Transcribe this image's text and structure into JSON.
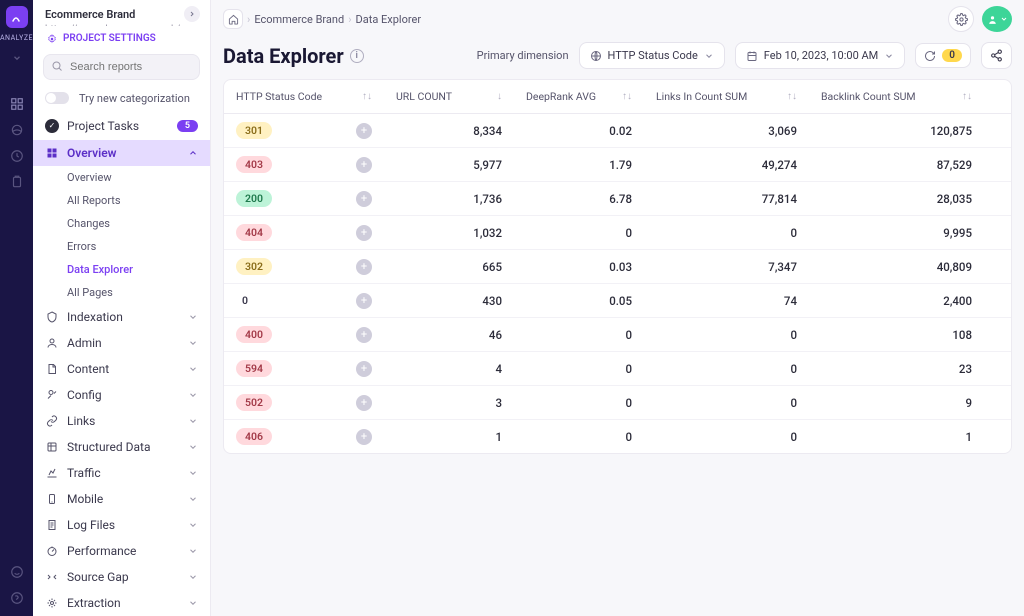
{
  "rail": {
    "label": "ANALYZE"
  },
  "project": {
    "name": "Ecommerce Brand",
    "url": "https://www.dc.ecomm.co.uk/",
    "settings_label": "PROJECT SETTINGS"
  },
  "search": {
    "placeholder": "Search reports"
  },
  "toggle": {
    "label": "Try new categorization"
  },
  "tasks": {
    "label": "Project Tasks",
    "count": "5"
  },
  "overview": {
    "label": "Overview",
    "items": [
      "Overview",
      "All Reports",
      "Changes",
      "Errors",
      "Data Explorer",
      "All Pages"
    ],
    "active_index": 4
  },
  "sections": [
    "Indexation",
    "Admin",
    "Content",
    "Config",
    "Links",
    "Structured Data",
    "Traffic",
    "Mobile",
    "Log Files",
    "Performance",
    "Source Gap",
    "Extraction"
  ],
  "breadcrumbs": [
    "Ecommerce Brand",
    "Data Explorer"
  ],
  "page_title": "Data Explorer",
  "primary_dimension": {
    "label": "Primary dimension",
    "value": "HTTP Status Code"
  },
  "date": "Feb 10, 2023, 10:00 AM",
  "issues_count": "0",
  "table": {
    "columns": [
      "HTTP Status Code",
      "URL COUNT",
      "DeepRank AVG",
      "Links In Count SUM",
      "Backlink Count SUM"
    ],
    "rows": [
      {
        "status": "301",
        "cls": "sp-301",
        "url_count": "8,334",
        "deeprank": "0.02",
        "links_in": "3,069",
        "backlink": "120,875"
      },
      {
        "status": "403",
        "cls": "sp-403",
        "url_count": "5,977",
        "deeprank": "1.79",
        "links_in": "49,274",
        "backlink": "87,529"
      },
      {
        "status": "200",
        "cls": "sp-200",
        "url_count": "1,736",
        "deeprank": "6.78",
        "links_in": "77,814",
        "backlink": "28,035"
      },
      {
        "status": "404",
        "cls": "sp-404",
        "url_count": "1,032",
        "deeprank": "0",
        "links_in": "0",
        "backlink": "9,995"
      },
      {
        "status": "302",
        "cls": "sp-302",
        "url_count": "665",
        "deeprank": "0.03",
        "links_in": "7,347",
        "backlink": "40,809"
      },
      {
        "status": "0",
        "cls": "sp-0",
        "url_count": "430",
        "deeprank": "0.05",
        "links_in": "74",
        "backlink": "2,400"
      },
      {
        "status": "400",
        "cls": "sp-400",
        "url_count": "46",
        "deeprank": "0",
        "links_in": "0",
        "backlink": "108"
      },
      {
        "status": "594",
        "cls": "sp-594",
        "url_count": "4",
        "deeprank": "0",
        "links_in": "0",
        "backlink": "23"
      },
      {
        "status": "502",
        "cls": "sp-502",
        "url_count": "3",
        "deeprank": "0",
        "links_in": "0",
        "backlink": "9"
      },
      {
        "status": "406",
        "cls": "sp-406",
        "url_count": "1",
        "deeprank": "0",
        "links_in": "0",
        "backlink": "1"
      }
    ]
  }
}
